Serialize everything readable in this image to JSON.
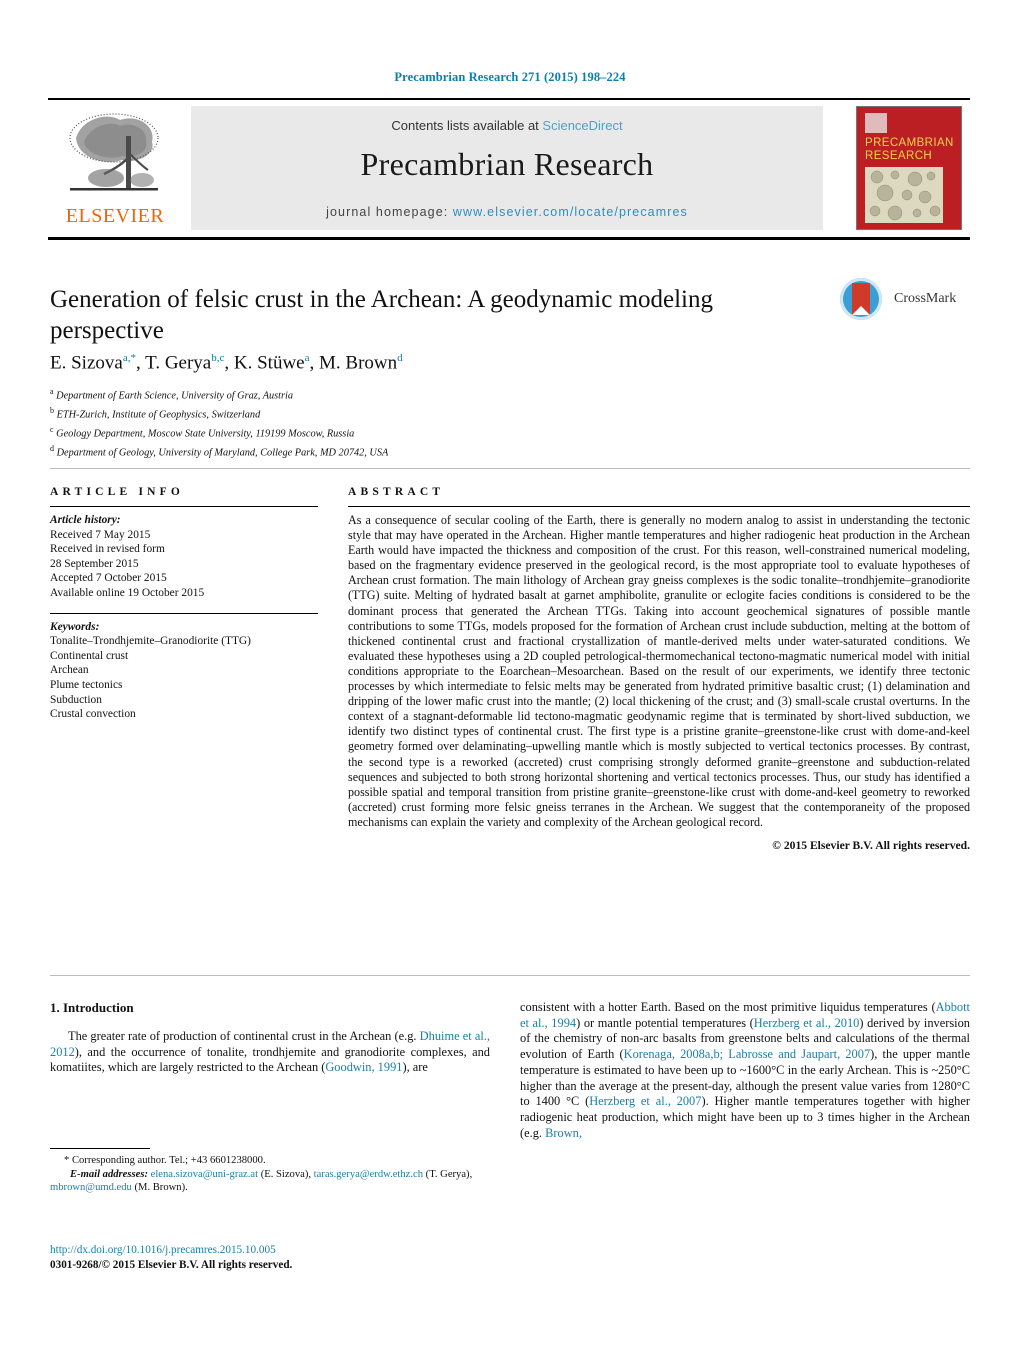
{
  "running_head": "Precambrian Research 271 (2015) 198–224",
  "masthead": {
    "contents_prefix": "Contents lists available at ",
    "sciencedirect": "ScienceDirect",
    "journal_title": "Precambrian Research",
    "homepage_prefix": "journal homepage: ",
    "homepage_url": "www.elsevier.com/locate/precamres",
    "publisher_logo_text": "ELSEVIER",
    "cover_title_line1": "PRECAMBRIAN",
    "cover_title_line2": "RESEARCH",
    "colors": {
      "link_blue": "#2a8fc4",
      "elsevier_orange": "#eb6607",
      "cover_red": "#bb1f24",
      "cover_yellow": "#f2d24b",
      "panel_grey": "#e9e9e9"
    }
  },
  "article": {
    "title": "Generation of felsic crust in the Archean: A geodynamic modeling perspective",
    "crossmark_label": "CrossMark",
    "authors_html": "E. Sizova<sup>a,*</sup>, T. Gerya<sup>b,c</sup>, K. Stüwe<sup>a</sup>, M. Brown<sup>d</sup>",
    "affiliations": [
      {
        "mark": "a",
        "text": "Department of Earth Science, University of Graz, Austria"
      },
      {
        "mark": "b",
        "text": "ETH-Zurich, Institute of Geophysics, Switzerland"
      },
      {
        "mark": "c",
        "text": "Geology Department, Moscow State University, 119199 Moscow, Russia"
      },
      {
        "mark": "d",
        "text": "Department of Geology, University of Maryland, College Park, MD 20742, USA"
      }
    ]
  },
  "article_info": {
    "heading": "ARTICLE INFO",
    "history_label": "Article history:",
    "history": [
      "Received 7 May 2015",
      "Received in revised form",
      "28 September 2015",
      "Accepted 7 October 2015",
      "Available online 19 October 2015"
    ],
    "keywords_label": "Keywords:",
    "keywords": [
      "Tonalite–Trondhjemite–Granodiorite (TTG)",
      "Continental crust",
      "Archean",
      "Plume tectonics",
      "Subduction",
      "Crustal convection"
    ]
  },
  "abstract": {
    "heading": "ABSTRACT",
    "text": "As a consequence of secular cooling of the Earth, there is generally no modern analog to assist in understanding the tectonic style that may have operated in the Archean. Higher mantle temperatures and higher radiogenic heat production in the Archean Earth would have impacted the thickness and composition of the crust. For this reason, well-constrained numerical modeling, based on the fragmentary evidence preserved in the geological record, is the most appropriate tool to evaluate hypotheses of Archean crust formation. The main lithology of Archean gray gneiss complexes is the sodic tonalite–trondhjemite–granodiorite (TTG) suite. Melting of hydrated basalt at garnet amphibolite, granulite or eclogite facies conditions is considered to be the dominant process that generated the Archean TTGs. Taking into account geochemical signatures of possible mantle contributions to some TTGs, models proposed for the formation of Archean crust include subduction, melting at the bottom of thickened continental crust and fractional crystallization of mantle-derived melts under water-saturated conditions. We evaluated these hypotheses using a 2D coupled petrological-thermomechanical tectono-magmatic numerical model with initial conditions appropriate to the Eoarchean–Mesoarchean. Based on the result of our experiments, we identify three tectonic processes by which intermediate to felsic melts may be generated from hydrated primitive basaltic crust; (1) delamination and dripping of the lower mafic crust into the mantle; (2) local thickening of the crust; and (3) small-scale crustal overturns. In the context of a stagnant-deformable lid tectono-magmatic geodynamic regime that is terminated by short-lived subduction, we identify two distinct types of continental crust. The first type is a pristine granite–greenstone-like crust with dome-and-keel geometry formed over delaminating–upwelling mantle which is mostly subjected to vertical tectonics processes. By contrast, the second type is a reworked (accreted) crust comprising strongly deformed granite–greenstone and subduction-related sequences and subjected to both strong horizontal shortening and vertical tectonics processes. Thus, our study has identified a possible spatial and temporal transition from pristine granite–greenstone-like crust with dome-and-keel geometry to reworked (accreted) crust forming more felsic gneiss terranes in the Archean. We suggest that the contemporaneity of the proposed mechanisms can explain the variety and complexity of the Archean geological record.",
    "copyright": "© 2015 Elsevier B.V. All rights reserved."
  },
  "body": {
    "section_heading": "1.  Introduction",
    "left_paragraph_html": "The greater rate of production of continental crust in the Archean (e.g. <a class=\"ref\" href=\"#\" data-name=\"citation-link\">Dhuime et al., 2012</a>), and the occurrence of tonalite, trondhjemite and granodiorite complexes, and komatiites, which are largely restricted to the Archean (<a class=\"ref\" href=\"#\" data-name=\"citation-link\">Goodwin, 1991</a>), are",
    "right_paragraph_html": "consistent with a hotter Earth. Based on the most primitive liquidus temperatures (<a class=\"ref\" href=\"#\" data-name=\"citation-link\">Abbott et al., 1994</a>) or mantle potential temperatures (<a class=\"ref\" href=\"#\" data-name=\"citation-link\">Herzberg et al., 2010</a>) derived by inversion of the chemistry of non-arc basalts from greenstone belts and calculations of the thermal evolution of Earth (<a class=\"ref\" href=\"#\" data-name=\"citation-link\">Korenaga, 2008a,b; Labrosse and Jaupart, 2007</a>), the upper mantle temperature is estimated to have been up to ~1600&#176;C in the early Archean. This is ~250&#176;C higher than the average at the present-day, although the present value varies from 1280&#176;C to 1400 &#176;C (<a class=\"ref\" href=\"#\" data-name=\"citation-link\">Herzberg et al., 2007</a>). Higher mantle temperatures together with higher radiogenic heat production, which might have been up to 3 times higher in the Archean (e.g. <a class=\"ref\" href=\"#\" data-name=\"citation-link\">Brown,</a>"
  },
  "footer": {
    "corresponding_html": "* Corresponding author. Tel.; +43 6601238000.",
    "email_label": "E-mail addresses:",
    "emails_html": "<a href=\"#\" data-name=\"email-link\">elena.sizova@uni-graz.at</a> (E. Sizova), <a href=\"#\" data-name=\"email-link\">taras.gerya@erdw.ethz.ch</a> (T. Gerya), <a href=\"#\" data-name=\"email-link\">mbrown@umd.edu</a> (M. Brown).",
    "doi_url": "http://dx.doi.org/10.1016/j.precamres.2015.10.005",
    "issn_line": "0301-9268/© 2015 Elsevier B.V. All rights reserved."
  }
}
